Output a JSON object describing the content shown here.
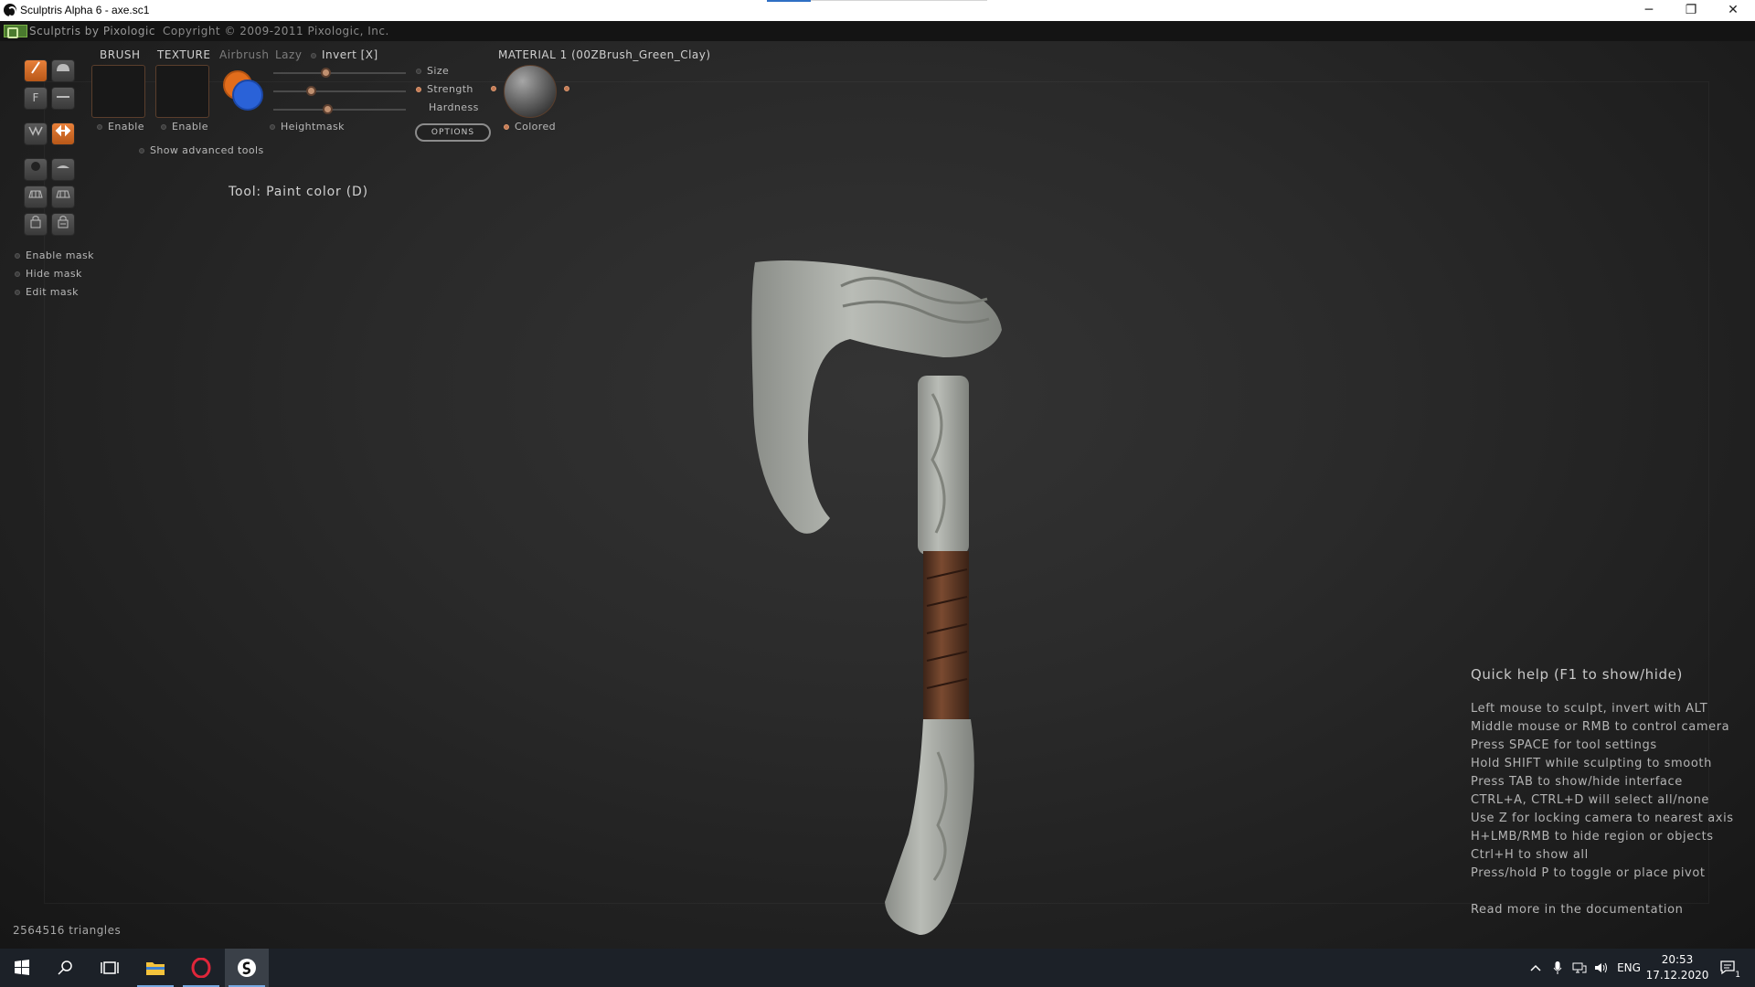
{
  "window": {
    "title": "Sculptris Alpha 6 - axe.sc1",
    "minimize_glyph": "─",
    "restore_glyph": "❐",
    "close_glyph": "✕"
  },
  "header": {
    "app_name": "Sculptris by Pixologic",
    "copyright": "Copyright © 2009-2011 Pixologic, Inc."
  },
  "top_panel": {
    "brush_label": "BRUSH",
    "texture_label": "TEXTURE",
    "airbrush_label": "Airbrush",
    "lazy_label": "Lazy",
    "invert_label": "Invert [X]",
    "brush_enable": "Enable",
    "texture_enable": "Enable",
    "show_advanced": "Show advanced tools",
    "heightmask": "Heightmask",
    "size_label": "Size",
    "strength_label": "Strength",
    "hardness_label": "Hardness",
    "options_label": "OPTIONS",
    "material_label": "MATERIAL 1 (00ZBrush_Green_Clay)",
    "colored_label": "Colored",
    "primary_color": "#e26d1c",
    "secondary_color": "#2a62d8",
    "sliders": {
      "size": 0.39,
      "strength": 0.28,
      "hardness": 0.41
    }
  },
  "left_toolbar": {
    "mask_options": [
      "Enable mask",
      "Hide mask",
      "Edit mask"
    ]
  },
  "status": {
    "tool": "Tool: Paint color (D)",
    "triangles": "2564516 triangles"
  },
  "quick_help": {
    "title": "Quick help (F1 to show/hide)",
    "lines": [
      "Left mouse to sculpt, invert with ALT",
      "Middle mouse or RMB to control camera",
      "Press SPACE for tool settings",
      "Hold SHIFT while sculpting to smooth",
      "Press TAB to show/hide interface",
      "CTRL+A, CTRL+D will select all/none",
      "Use Z for locking camera to nearest axis",
      "H+LMB/RMB to hide region or objects",
      "Ctrl+H to show all",
      "Press/hold P to toggle or place pivot"
    ],
    "more": "Read more in the documentation"
  },
  "taskbar": {
    "language": "ENG",
    "time": "20:53",
    "date": "17.12.2020",
    "notification_count": "1"
  }
}
